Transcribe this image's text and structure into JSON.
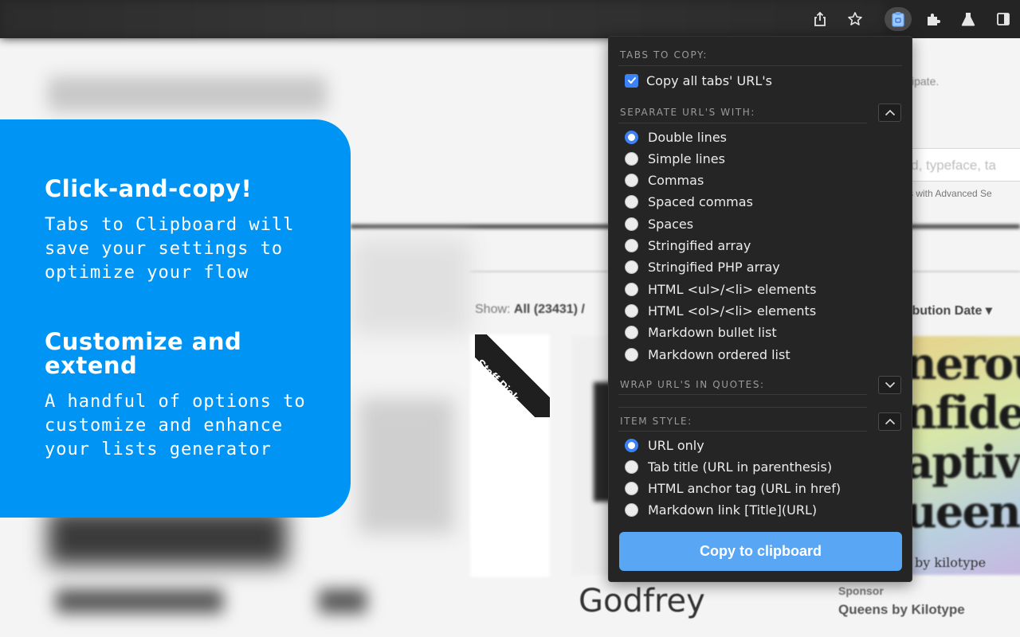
{
  "background_page": {
    "participate_text": "ticipate.",
    "search_placeholder": "ord, typeface, ta",
    "advanced_search": "ms with Advanced Se",
    "show_label": "Show:",
    "show_value": "All (23431) /",
    "sort_label": "ibution Date ▾",
    "staff_pick": "Staff Pick",
    "card_heading": "nerou\nnfider\naptiv\nueen",
    "card_brand": "by kilotype",
    "godfrey": "Godfrey",
    "sponsor_label": "Sponsor",
    "sponsor_title": "Queens by Kilotype"
  },
  "toolbar": {
    "icons": [
      "share-icon",
      "star-icon",
      "tabs-to-clipboard-icon",
      "puzzle-icon",
      "lab-flask-icon",
      "side-panel-icon"
    ],
    "active_color": "#4a4a4a"
  },
  "promo": {
    "heading1": "Click-and-copy!",
    "text1": "Tabs to Clipboard will save your settings to optimize your flow",
    "heading2": "Customize and extend",
    "text2": "A handful of options to customize and enhance your lists generator",
    "color": "#0094f5"
  },
  "popup": {
    "tabs_section": {
      "title": "TABS TO COPY:",
      "checkbox_label": "Copy all tabs' URL's",
      "checked": true
    },
    "separator_section": {
      "title": "SEPARATE URL'S WITH:",
      "expanded": true,
      "selected": "Double lines",
      "options": [
        "Double lines",
        "Simple lines",
        "Commas",
        "Spaced commas",
        "Spaces",
        "Stringified array",
        "Stringified PHP array",
        "HTML <ul>/<li> elements",
        "HTML <ol>/<li> elements",
        "Markdown bullet list",
        "Markdown ordered list"
      ]
    },
    "quotes_section": {
      "title": "WRAP URL'S IN QUOTES:",
      "expanded": false
    },
    "item_style_section": {
      "title": "ITEM STYLE:",
      "expanded": true,
      "selected": "URL only",
      "options": [
        "URL only",
        "Tab title (URL in parenthesis)",
        "HTML anchor tag (URL in href)",
        "Markdown link [Title](URL)"
      ]
    },
    "copy_button": "Copy to clipboard",
    "accent_color": "#3b82f6",
    "button_color": "#58a6f4"
  }
}
